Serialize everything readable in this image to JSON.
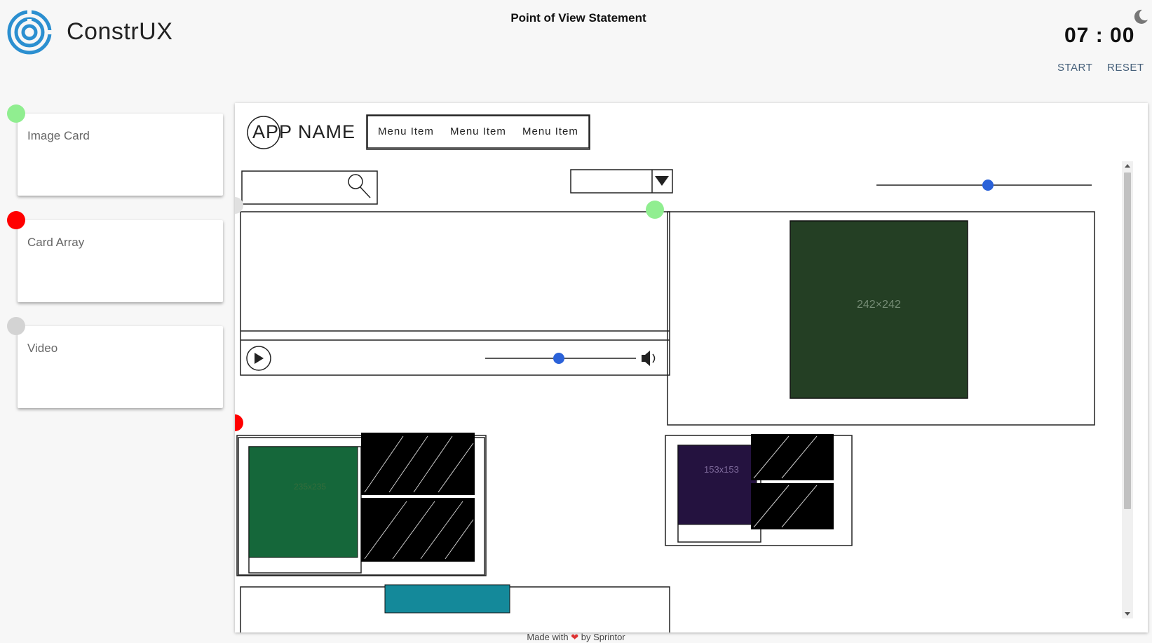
{
  "app": {
    "brand": "ConstrUX",
    "page_title": "Point of View Statement"
  },
  "timer": {
    "display": "07 : 00",
    "start_label": "START",
    "reset_label": "RESET"
  },
  "sidebar": {
    "items": [
      {
        "label": "Image Card",
        "status_color": "#90ee90"
      },
      {
        "label": "Card Array",
        "status_color": "#ff0000"
      },
      {
        "label": "Video",
        "status_color": "#d3d3d3"
      }
    ]
  },
  "sketch": {
    "app_name": "APP NAME",
    "menu_items": [
      "Menu Item",
      "Menu Item",
      "Menu Item"
    ],
    "image_large_label": "242×242",
    "image_left_label": "235x235",
    "image_right_label": "153x153",
    "video_volume_fraction": 0.5,
    "top_slider_fraction": 0.5,
    "colors": {
      "image_large": "#243f24",
      "image_left": "#15673a",
      "image_right": "#24123f",
      "image_bottom": "#14899a",
      "slider_knob": "#2b62d9"
    }
  },
  "footer": {
    "prefix": "Made with",
    "heart": "❤",
    "suffix": "by Sprintor"
  }
}
